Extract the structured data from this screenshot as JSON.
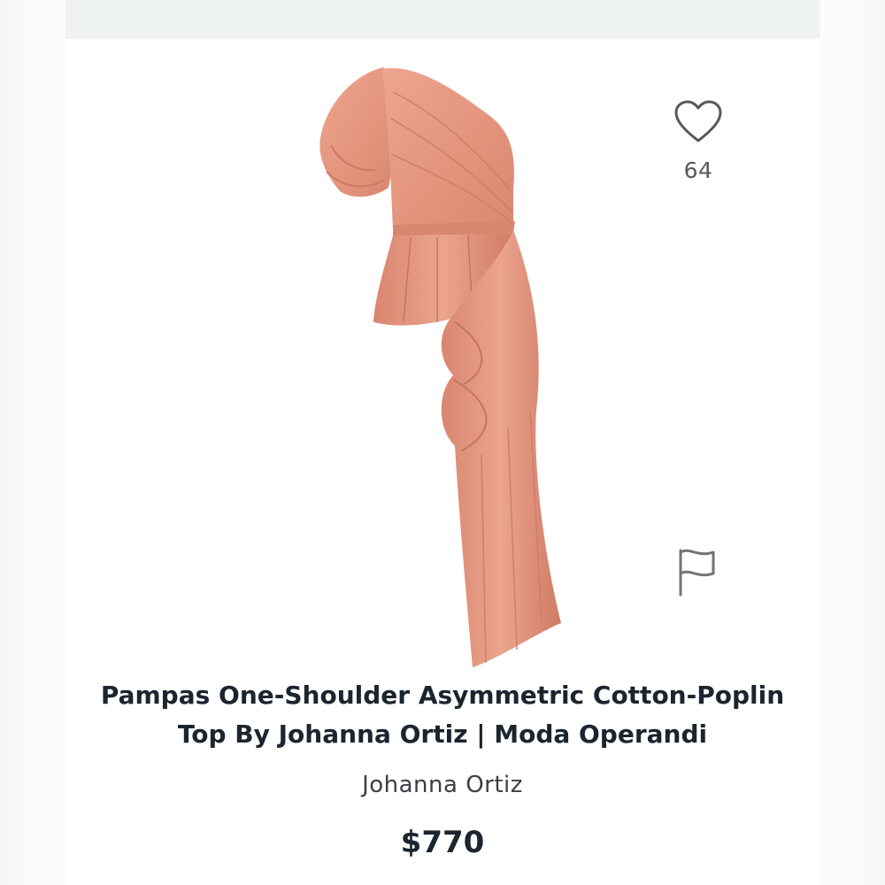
{
  "product": {
    "title_line1": "Pampas One-Shoulder Asymmetric Cotton-Poplin",
    "title_line2": "Top By Johanna Ortiz | Moda Operandi",
    "brand": "Johanna Ortiz",
    "price": "$770",
    "image_color": "#e69a84"
  },
  "actions": {
    "like_icon": "heart-icon",
    "like_count": "64",
    "report_icon": "flag-icon"
  }
}
